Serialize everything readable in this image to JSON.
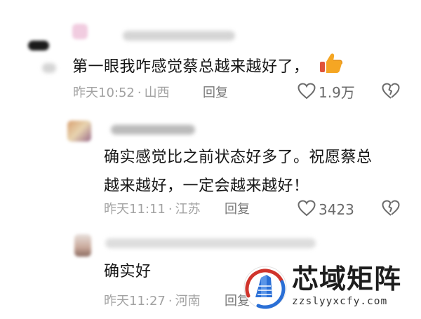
{
  "comments": [
    {
      "text": "第一眼我咋感觉蔡总越来越好了，",
      "emoji": "thumbs-up-emoji",
      "time": "昨天10:52",
      "location": "山西",
      "separator": "·",
      "reply_label": "回复",
      "like_count": "1.9万"
    },
    {
      "text_line1": "确实感觉比之前状态好多了。祝愿蔡总",
      "text_line2": "越来越好，一定会越来越好！",
      "time": "昨天11:11",
      "location": "江苏",
      "separator": "·",
      "reply_label": "回复",
      "like_count": "3423"
    },
    {
      "text": "确实好",
      "time": "昨天11:27",
      "location": "河南",
      "separator": "·",
      "reply_label": "回复"
    }
  ],
  "watermark": {
    "title": "芯域矩阵",
    "url": "zzslyyxcfy.com"
  },
  "colors": {
    "text": "#161616",
    "meta": "#a2a2a2",
    "like": "#6a6a6a",
    "thumb": "#f5a623",
    "logo_blue": "#2a6fd6",
    "logo_red": "#d0342c"
  }
}
